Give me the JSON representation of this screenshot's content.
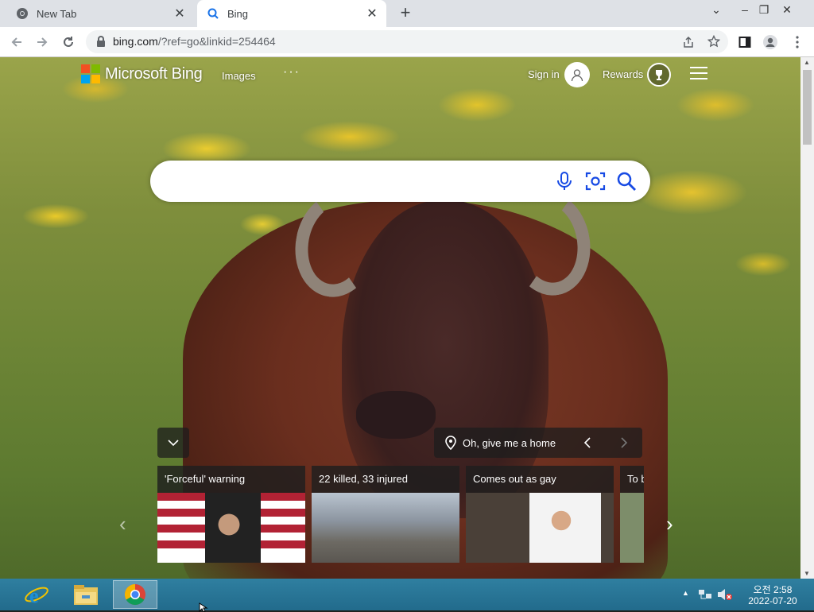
{
  "browser": {
    "tabs": [
      {
        "title": "New Tab",
        "icon": "chrome-icon",
        "active": false
      },
      {
        "title": "Bing",
        "icon": "bing-search-icon",
        "active": true
      }
    ],
    "url_host": "bing.com",
    "url_rest": "/?ref=go&linkid=254464"
  },
  "bing": {
    "logo_text": "Microsoft Bing",
    "nav_images": "Images",
    "nav_more": "···",
    "signin": "Sign in",
    "rewards": "Rewards",
    "search_placeholder": "",
    "location_label": "Oh, give me a home",
    "news_cards": [
      {
        "headline": "'Forceful' warning"
      },
      {
        "headline": "22 killed, 33 injured"
      },
      {
        "headline": "Comes out as gay"
      },
      {
        "headline": "To b"
      }
    ],
    "colors": {
      "ms_red": "#f25022",
      "ms_green": "#7fba00",
      "ms_blue": "#00a4ef",
      "ms_yellow": "#ffb900"
    }
  },
  "taskbar": {
    "apps": [
      "internet-explorer-icon",
      "file-explorer-icon",
      "chrome-icon"
    ],
    "clock_time": "오전 2:58",
    "clock_date": "2022-07-20"
  }
}
